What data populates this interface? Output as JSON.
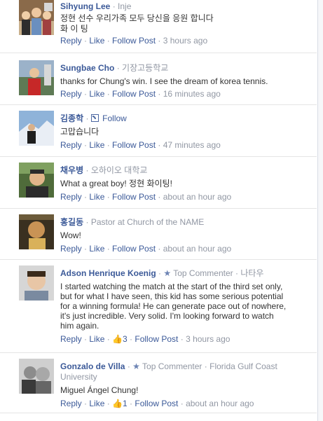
{
  "comments": [
    {
      "author": "Sihyung Lee",
      "meta": "Inje",
      "text_lines": [
        "정현 선수 우리가족 모두 당신을 응원 합니다",
        "화 이 팅"
      ],
      "reply": "Reply",
      "like": "Like",
      "follow_post": "Follow Post",
      "time": "3 hours ago"
    },
    {
      "author": "Sungbae Cho",
      "meta": "기장고등학교",
      "text_lines": [
        "thanks for Chung's win. I see the dream of korea tennis."
      ],
      "reply": "Reply",
      "like": "Like",
      "follow_post": "Follow Post",
      "time": "16 minutes ago"
    },
    {
      "author": "김종학",
      "follow": "Follow",
      "text_lines": [
        "고맙습니다"
      ],
      "reply": "Reply",
      "like": "Like",
      "follow_post": "Follow Post",
      "time": "47 minutes ago"
    },
    {
      "author": "채우병",
      "meta": "오하이오 대학교",
      "text_lines": [
        "What a great boy! 정현 화이팅!"
      ],
      "reply": "Reply",
      "like": "Like",
      "follow_post": "Follow Post",
      "time": "about an hour ago"
    },
    {
      "author": "홍길동",
      "meta": "Pastor at Church of the NAME",
      "text_lines": [
        "Wow!"
      ],
      "reply": "Reply",
      "like": "Like",
      "follow_post": "Follow Post",
      "time": "about an hour ago"
    },
    {
      "author": "Adson Henrique Koenig",
      "badge": "Top Commenter",
      "meta": "나타우",
      "text_lines": [
        "I started watching the match at the start of the third set only,",
        "but for what I have seen, this kid has some serious potential",
        "for a winning formula! He can generate pace out of nowhere,",
        "it's just incredible. Very solid. I'm looking forward to watch",
        "him again."
      ],
      "reply": "Reply",
      "like": "Like",
      "likes": "3",
      "follow_post": "Follow Post",
      "time": "3 hours ago"
    },
    {
      "author": "Gonzalo de Villa",
      "badge": "Top Commenter",
      "meta": "Florida Gulf Coast",
      "meta_line2": "University",
      "text_lines": [
        "Miguel Ángel Chung!"
      ],
      "reply": "Reply",
      "like": "Like",
      "likes": "1",
      "follow_post": "Follow Post",
      "time": "about an hour ago"
    }
  ],
  "colors": {
    "link": "#3b5998",
    "muted": "#9197a3",
    "text": "#333333",
    "divider": "#e5e5e5"
  }
}
